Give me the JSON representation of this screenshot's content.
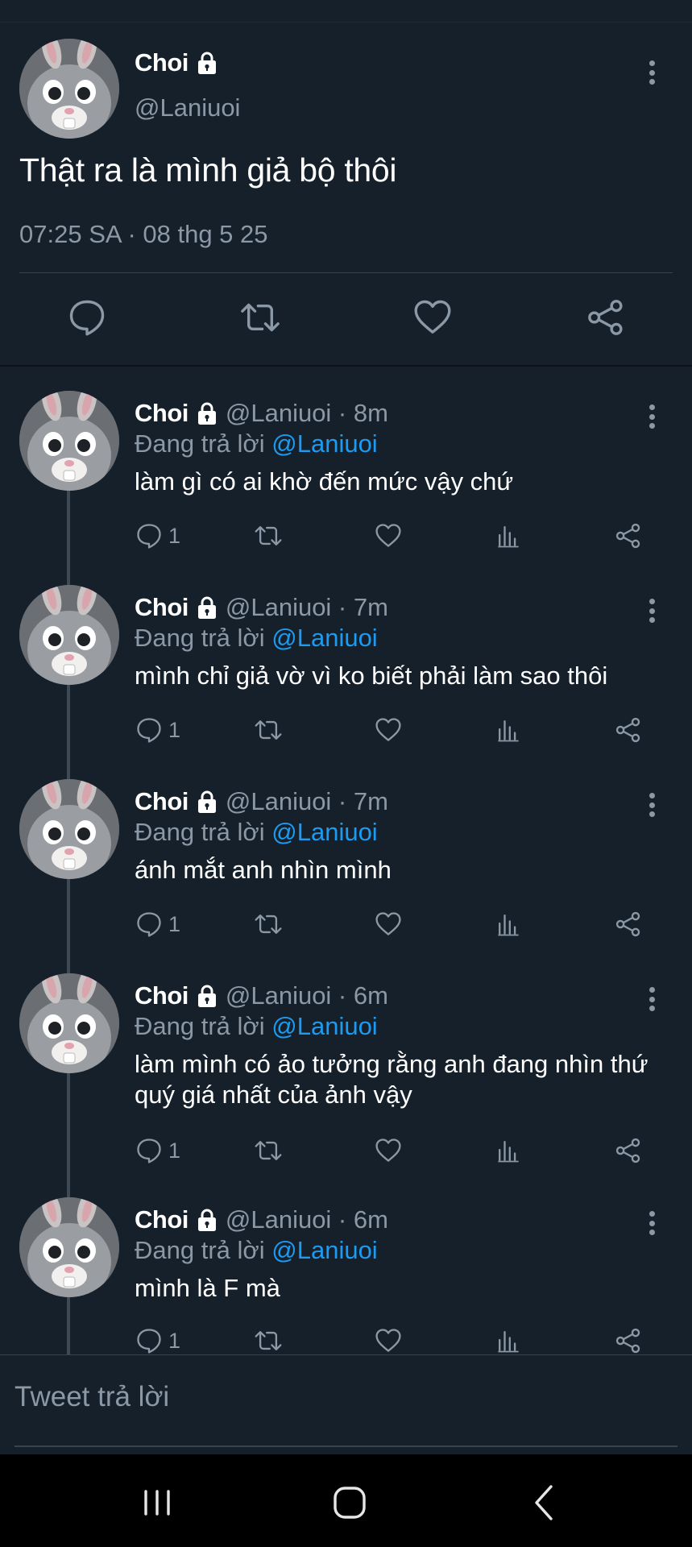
{
  "colors": {
    "background": "#15202b",
    "text_primary": "#ffffff",
    "text_secondary": "#8b98a5",
    "accent_link": "#1d9bf0",
    "divider": "#38444d",
    "navbar": "#000000"
  },
  "main_tweet": {
    "author_name": "Choi",
    "protected_icon": "lock-icon",
    "handle": "@Laniuoi",
    "text": "Thật ra là mình giả bộ thôi",
    "timestamp": "07:25 SA · 08 thg 5 25",
    "actions": [
      {
        "name": "reply-button",
        "icon": "comment-icon"
      },
      {
        "name": "retweet-button",
        "icon": "retweet-icon"
      },
      {
        "name": "like-button",
        "icon": "heart-icon"
      },
      {
        "name": "share-button",
        "icon": "share-icon"
      }
    ]
  },
  "replying_prefix": "Đang trả lời",
  "replies": [
    {
      "author_name": "Choi",
      "handle_time": "@Laniuoi · 8m",
      "replying_to": "@Laniuoi",
      "text": "làm gì có ai khờ đến mức vậy chứ",
      "reply_count": "1"
    },
    {
      "author_name": "Choi",
      "handle_time": "@Laniuoi · 7m",
      "replying_to": "@Laniuoi",
      "text": "mình chỉ giả vờ vì ko biết phải làm sao thôi",
      "reply_count": "1"
    },
    {
      "author_name": "Choi",
      "handle_time": "@Laniuoi · 7m",
      "replying_to": "@Laniuoi",
      "text": "ánh mắt anh nhìn mình",
      "reply_count": "1"
    },
    {
      "author_name": "Choi",
      "handle_time": "@Laniuoi · 6m",
      "replying_to": "@Laniuoi",
      "text": "làm mình có ảo tưởng rằng anh đang nhìn thứ quý giá nhất của ảnh vậy",
      "reply_count": "1"
    },
    {
      "author_name": "Choi",
      "handle_time": "@Laniuoi · 6m",
      "replying_to": "@Laniuoi",
      "text": "mình là F mà",
      "reply_count": "1"
    }
  ],
  "reply_box": {
    "placeholder": "Tweet trả lời"
  },
  "navbar": {
    "buttons": [
      {
        "name": "recent-apps-button",
        "icon": "recent-apps-icon"
      },
      {
        "name": "home-button",
        "icon": "home-icon"
      },
      {
        "name": "back-button",
        "icon": "back-icon"
      }
    ]
  }
}
